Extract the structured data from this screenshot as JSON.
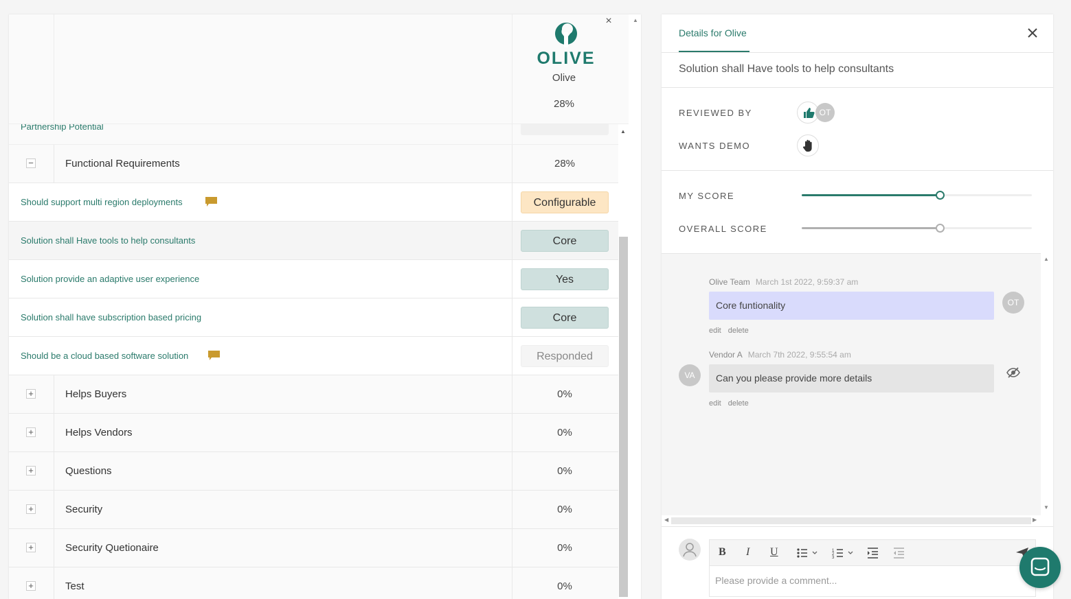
{
  "vendor_column": {
    "logo_text": "OLIVE",
    "name": "Olive",
    "overall_pct": "28%",
    "close_label": "×"
  },
  "cut_row": {
    "label": "Partnership Potential"
  },
  "groups": {
    "functional": {
      "toggle": "−",
      "label": "Functional Requirements",
      "pct": "28%"
    },
    "helps_buyers": {
      "toggle": "+",
      "label": "Helps Buyers",
      "pct": "0%"
    },
    "helps_vendors": {
      "toggle": "+",
      "label": "Helps Vendors",
      "pct": "0%"
    },
    "questions": {
      "toggle": "+",
      "label": "Questions",
      "pct": "0%"
    },
    "security": {
      "toggle": "+",
      "label": "Security",
      "pct": "0%"
    },
    "security_q": {
      "toggle": "+",
      "label": "Security Quetionaire",
      "pct": "0%"
    },
    "test": {
      "toggle": "+",
      "label": "Test",
      "pct": "0%"
    }
  },
  "requirements": [
    {
      "label": "Should support multi region deployments",
      "response": "Configurable",
      "has_comment": true
    },
    {
      "label": "Solution shall Have tools to help consultants",
      "response": "Core",
      "has_comment": false
    },
    {
      "label": "Solution provide an adaptive user experience",
      "response": "Yes",
      "has_comment": false
    },
    {
      "label": "Solution shall have subscription based pricing",
      "response": "Core",
      "has_comment": false
    },
    {
      "label": "Should be a cloud based software solution",
      "response": "Responded",
      "has_comment": true
    }
  ],
  "details": {
    "tab_label": "Details for Olive",
    "title": "Solution shall Have tools to help consultants",
    "reviewed_by_label": "REVIEWED BY",
    "reviewer_initials": "OT",
    "wants_demo_label": "WANTS DEMO",
    "my_score_label": "MY SCORE",
    "overall_score_label": "OVERALL SCORE",
    "my_score_fraction": 0.6,
    "overall_score_fraction": 0.6
  },
  "comments": [
    {
      "author": "Olive Team",
      "timestamp": "March 1st 2022, 9:59:37 am",
      "text": "Core funtionality",
      "initials": "OT",
      "edit": "edit",
      "delete": "delete"
    },
    {
      "author": "Vendor A",
      "timestamp": "March 7th 2022, 9:55:54 am",
      "text": "Can you please provide more details",
      "initials": "VA",
      "edit": "edit",
      "delete": "delete"
    }
  ],
  "composer": {
    "placeholder": "Please provide a comment...",
    "bold": "B",
    "italic": "I",
    "underline": "U"
  },
  "colors": {
    "accent": "#2a7a6b",
    "slider_mine": "#2a7a6b",
    "slider_overall": "#b0b0b0",
    "comment_flag": "#c99a2e"
  }
}
